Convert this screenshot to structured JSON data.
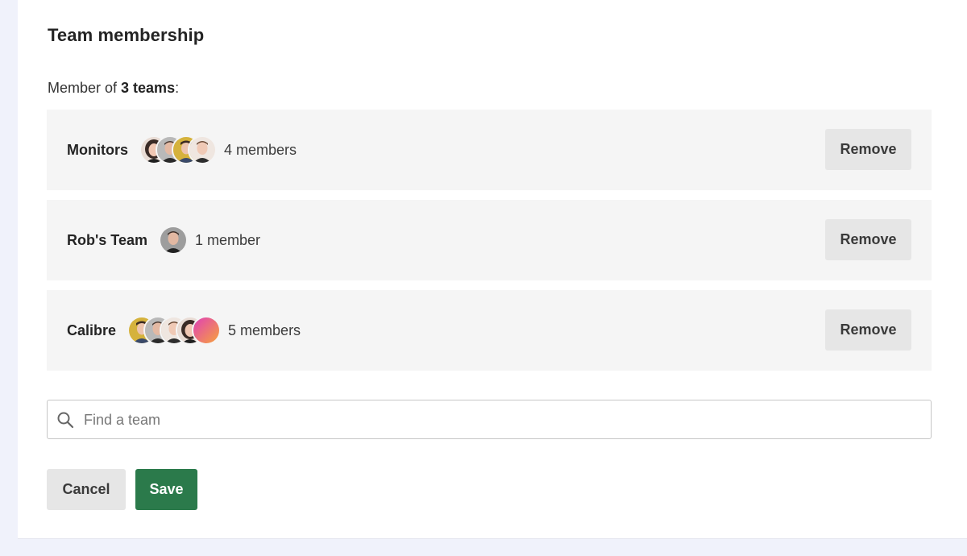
{
  "page": {
    "title": "Team membership",
    "summary_prefix": "Member of ",
    "summary_count": "3 teams",
    "summary_suffix": ":"
  },
  "teams": [
    {
      "name": "Monitors",
      "members_label": "4 members",
      "remove_label": "Remove",
      "avatars": [
        "woman-dark-hair",
        "man-grey",
        "man-yellow-bg",
        "man-light"
      ]
    },
    {
      "name": "Rob's Team",
      "members_label": "1 member",
      "remove_label": "Remove",
      "avatars": [
        "man-grey"
      ]
    },
    {
      "name": "Calibre",
      "members_label": "5 members",
      "remove_label": "Remove",
      "avatars": [
        "man-yellow-bg",
        "man-grey",
        "man-light",
        "woman-dark-hair",
        "gradient-pink-orange"
      ]
    }
  ],
  "search": {
    "placeholder": "Find a team",
    "value": "",
    "icon": "search-icon"
  },
  "actions": {
    "cancel_label": "Cancel",
    "save_label": "Save"
  },
  "colors": {
    "save_button": "#2b7a4b",
    "secondary_button": "#e6e6e6",
    "row_background": "#f5f5f5",
    "page_background": "#f0f2fb"
  }
}
